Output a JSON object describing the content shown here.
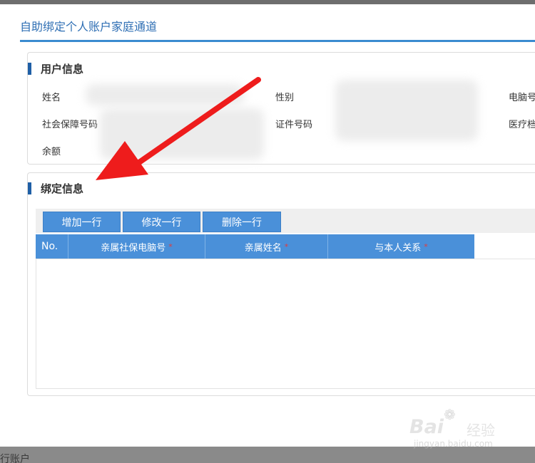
{
  "page": {
    "title": "自助绑定个人账户家庭通道",
    "bottom_text": "行账户"
  },
  "user_info": {
    "section_title": "用户信息",
    "fields": {
      "name": "姓名",
      "gender": "性别",
      "computer_no": "电脑号",
      "social_security_no": "社会保障号码",
      "id_no": "证件号码",
      "medical": "医疗档",
      "balance": "余额"
    }
  },
  "bind_info": {
    "section_title": "绑定信息",
    "toolbar": {
      "add_row": "增加一行",
      "edit_row": "修改一行",
      "delete_row": "删除一行"
    },
    "table": {
      "columns": [
        "No.",
        "亲属社保电脑号",
        "亲属姓名",
        "与本人关系"
      ],
      "required_mark": "*",
      "rows": []
    }
  },
  "watermark": {
    "logo": "Bai",
    "suffix": "经验",
    "url": "jingyan.baidu.com"
  },
  "colors": {
    "accent": "#4a90d9",
    "title": "#2f6fb4",
    "section_bar": "#1f5fa6",
    "arrow": "#ee1c1c",
    "required": "#e23b3b"
  }
}
